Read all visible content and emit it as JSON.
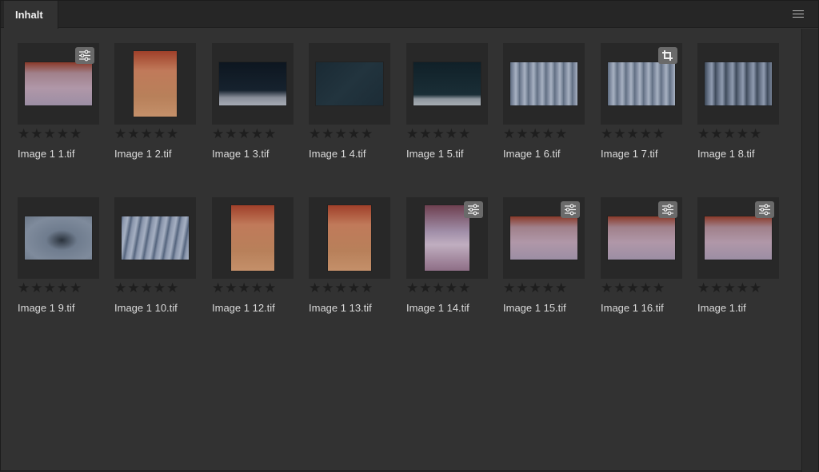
{
  "panel": {
    "tab_label": "Inhalt",
    "menu_icon": "hamburger-menu-icon"
  },
  "items": [
    {
      "filename": "Image 1 1.tif",
      "rating": 0,
      "badge": "adjustments-icon",
      "orient": "landscape",
      "tone": "portrait-pink"
    },
    {
      "filename": "Image 1 2.tif",
      "rating": 0,
      "badge": null,
      "orient": "portrait",
      "tone": "orange"
    },
    {
      "filename": "Image 1 3.tif",
      "rating": 0,
      "badge": null,
      "orient": "landscape",
      "tone": "night-tree"
    },
    {
      "filename": "Image 1 4.tif",
      "rating": 0,
      "badge": null,
      "orient": "landscape",
      "tone": "dark-teal"
    },
    {
      "filename": "Image 1 5.tif",
      "rating": 0,
      "badge": null,
      "orient": "landscape",
      "tone": "dark-horizon"
    },
    {
      "filename": "Image 1 6.tif",
      "rating": 0,
      "badge": null,
      "orient": "landscape",
      "tone": "forest"
    },
    {
      "filename": "Image 1 7.tif",
      "rating": 0,
      "badge": "crop-icon",
      "orient": "landscape",
      "tone": "forest"
    },
    {
      "filename": "Image 1 8.tif",
      "rating": 0,
      "badge": null,
      "orient": "landscape",
      "tone": "forest-dark"
    },
    {
      "filename": "Image 1 9.tif",
      "rating": 0,
      "badge": null,
      "orient": "landscape",
      "tone": "water"
    },
    {
      "filename": "Image 1 10.tif",
      "rating": 0,
      "badge": null,
      "orient": "landscape",
      "tone": "branches"
    },
    {
      "filename": "Image 1 12.tif",
      "rating": 0,
      "badge": null,
      "orient": "portrait",
      "tone": "orange"
    },
    {
      "filename": "Image 1 13.tif",
      "rating": 0,
      "badge": null,
      "orient": "portrait",
      "tone": "orange"
    },
    {
      "filename": "Image 1 14.tif",
      "rating": 0,
      "badge": "adjustments-icon",
      "orient": "portrait-wide",
      "tone": "face-violet"
    },
    {
      "filename": "Image 1 15.tif",
      "rating": 0,
      "badge": "adjustments-icon",
      "orient": "landscape",
      "tone": "portrait-pink"
    },
    {
      "filename": "Image 1 16.tif",
      "rating": 0,
      "badge": "adjustments-icon",
      "orient": "landscape",
      "tone": "portrait-pink"
    },
    {
      "filename": "Image 1.tif",
      "rating": 0,
      "badge": "adjustments-icon",
      "orient": "landscape",
      "tone": "portrait-pink"
    }
  ],
  "max_rating": 5,
  "colors": {
    "panel_bg": "#323232",
    "tab_bg": "#262626",
    "thumb_bg": "#282828",
    "star_empty": "#1e1e1e",
    "badge_bg": "#6a6a6a"
  }
}
